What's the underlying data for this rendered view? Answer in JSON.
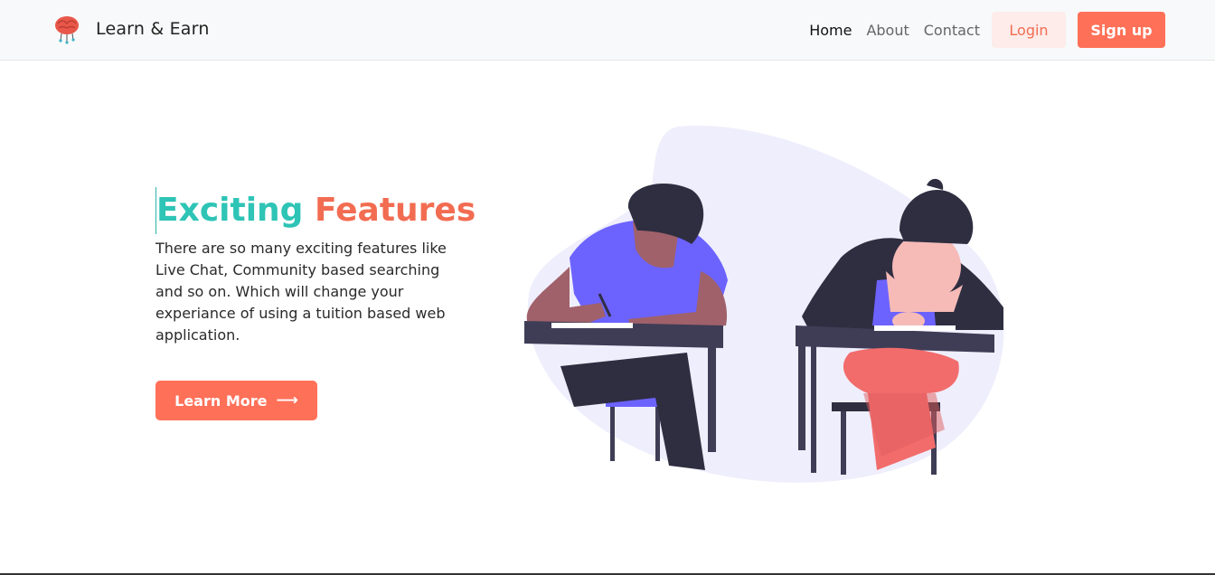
{
  "brand": {
    "name": "Learn & Earn",
    "logo_icon": "brain-icon"
  },
  "nav": {
    "links": [
      {
        "label": "Home",
        "active": true
      },
      {
        "label": "About",
        "active": false
      },
      {
        "label": "Contact",
        "active": false
      }
    ],
    "login_label": "Login",
    "signup_label": "Sign up"
  },
  "hero": {
    "title_part1": "Exciting",
    "title_part2": "Features",
    "description": "There are so many exciting features like Live Chat, Community based searching and so on. Which will change your experiance of using a tuition based web application.",
    "cta_label": "Learn More",
    "cta_icon": "arrow-right-icon"
  },
  "illustration": {
    "subject": "students-writing-exam-illustration"
  },
  "colors": {
    "accent": "#ff7058",
    "teal": "#2ec4b6",
    "purple": "#6c63ff",
    "blob": "#efeefc"
  }
}
